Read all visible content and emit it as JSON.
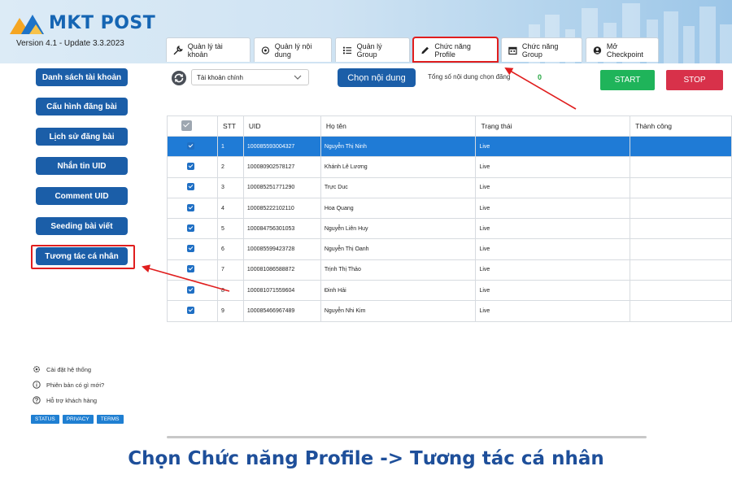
{
  "app": {
    "brand": "MKT POST",
    "version": "Version 4.1 - Update 3.3.2023",
    "accent": "#1b5ea8",
    "highlight_color": "#e01e1e"
  },
  "tabs": [
    {
      "label": "Quản lý tài khoản",
      "icon": "wrench-icon"
    },
    {
      "label": "Quản lý nội dung",
      "icon": "content-icon"
    },
    {
      "label": "Quản lý Group",
      "icon": "list-icon"
    },
    {
      "label": "Chức năng Profile",
      "icon": "pencil-icon",
      "highlighted": true
    },
    {
      "label": "Chức năng Group",
      "icon": "calendar-icon"
    },
    {
      "label": "Mở Checkpoint",
      "icon": "user-circle-icon"
    }
  ],
  "sidebar": {
    "items": [
      {
        "label": "Danh sách tài khoản"
      },
      {
        "label": "Cấu hình đăng bài"
      },
      {
        "label": "Lịch sử đăng bài"
      },
      {
        "label": "Nhắn tin UID"
      },
      {
        "label": "Comment UID"
      },
      {
        "label": "Seeding bài viết"
      },
      {
        "label": "Tương tác cá nhân",
        "highlighted": true
      }
    ],
    "links": [
      {
        "label": "Cài đặt hệ thống",
        "icon": "gear-icon"
      },
      {
        "label": "Phiên bản có gì mới?",
        "icon": "info-icon"
      },
      {
        "label": "Hỗ trợ khách hàng",
        "icon": "help-icon"
      }
    ],
    "footer_buttons": [
      "STATUS",
      "PRIVACY",
      "TERMS"
    ]
  },
  "toolbar": {
    "account_select": "Tài khoản chính",
    "choose_button": "Chọn nội dung",
    "total_label": "Tổng số nội dung chọn đăng",
    "total_count": "0",
    "start": "START",
    "stop": "STOP"
  },
  "table": {
    "columns": [
      "STT",
      "UID",
      "Họ tên",
      "Trạng thái",
      "Thành công"
    ],
    "rows": [
      {
        "stt": "1",
        "uid": "100085593004327",
        "name": "Nguyễn Thị Ninh",
        "status": "Live",
        "success": "",
        "selected": true
      },
      {
        "stt": "2",
        "uid": "100080902578127",
        "name": "Khánh Lê Lương",
        "status": "Live",
        "success": ""
      },
      {
        "stt": "3",
        "uid": "100085251771290",
        "name": "Trực Duc",
        "status": "Live",
        "success": ""
      },
      {
        "stt": "4",
        "uid": "100085222102110",
        "name": "Hoa Quang",
        "status": "Live",
        "success": ""
      },
      {
        "stt": "5",
        "uid": "100084756301053",
        "name": "Nguyễn Liên Huy",
        "status": "Live",
        "success": ""
      },
      {
        "stt": "6",
        "uid": "100085599423728",
        "name": "Nguyễn Thị Oanh",
        "status": "Live",
        "success": ""
      },
      {
        "stt": "7",
        "uid": "100081086588872",
        "name": "Trịnh Thị Thảo",
        "status": "Live",
        "success": ""
      },
      {
        "stt": "8",
        "uid": "100081071559604",
        "name": "Đinh Hải",
        "status": "Live",
        "success": ""
      },
      {
        "stt": "9",
        "uid": "100085466967489",
        "name": "Nguyễn Nhi Kim",
        "status": "Live",
        "success": ""
      }
    ]
  },
  "caption": "Chọn Chức năng Profile -> Tương tác cá nhân"
}
